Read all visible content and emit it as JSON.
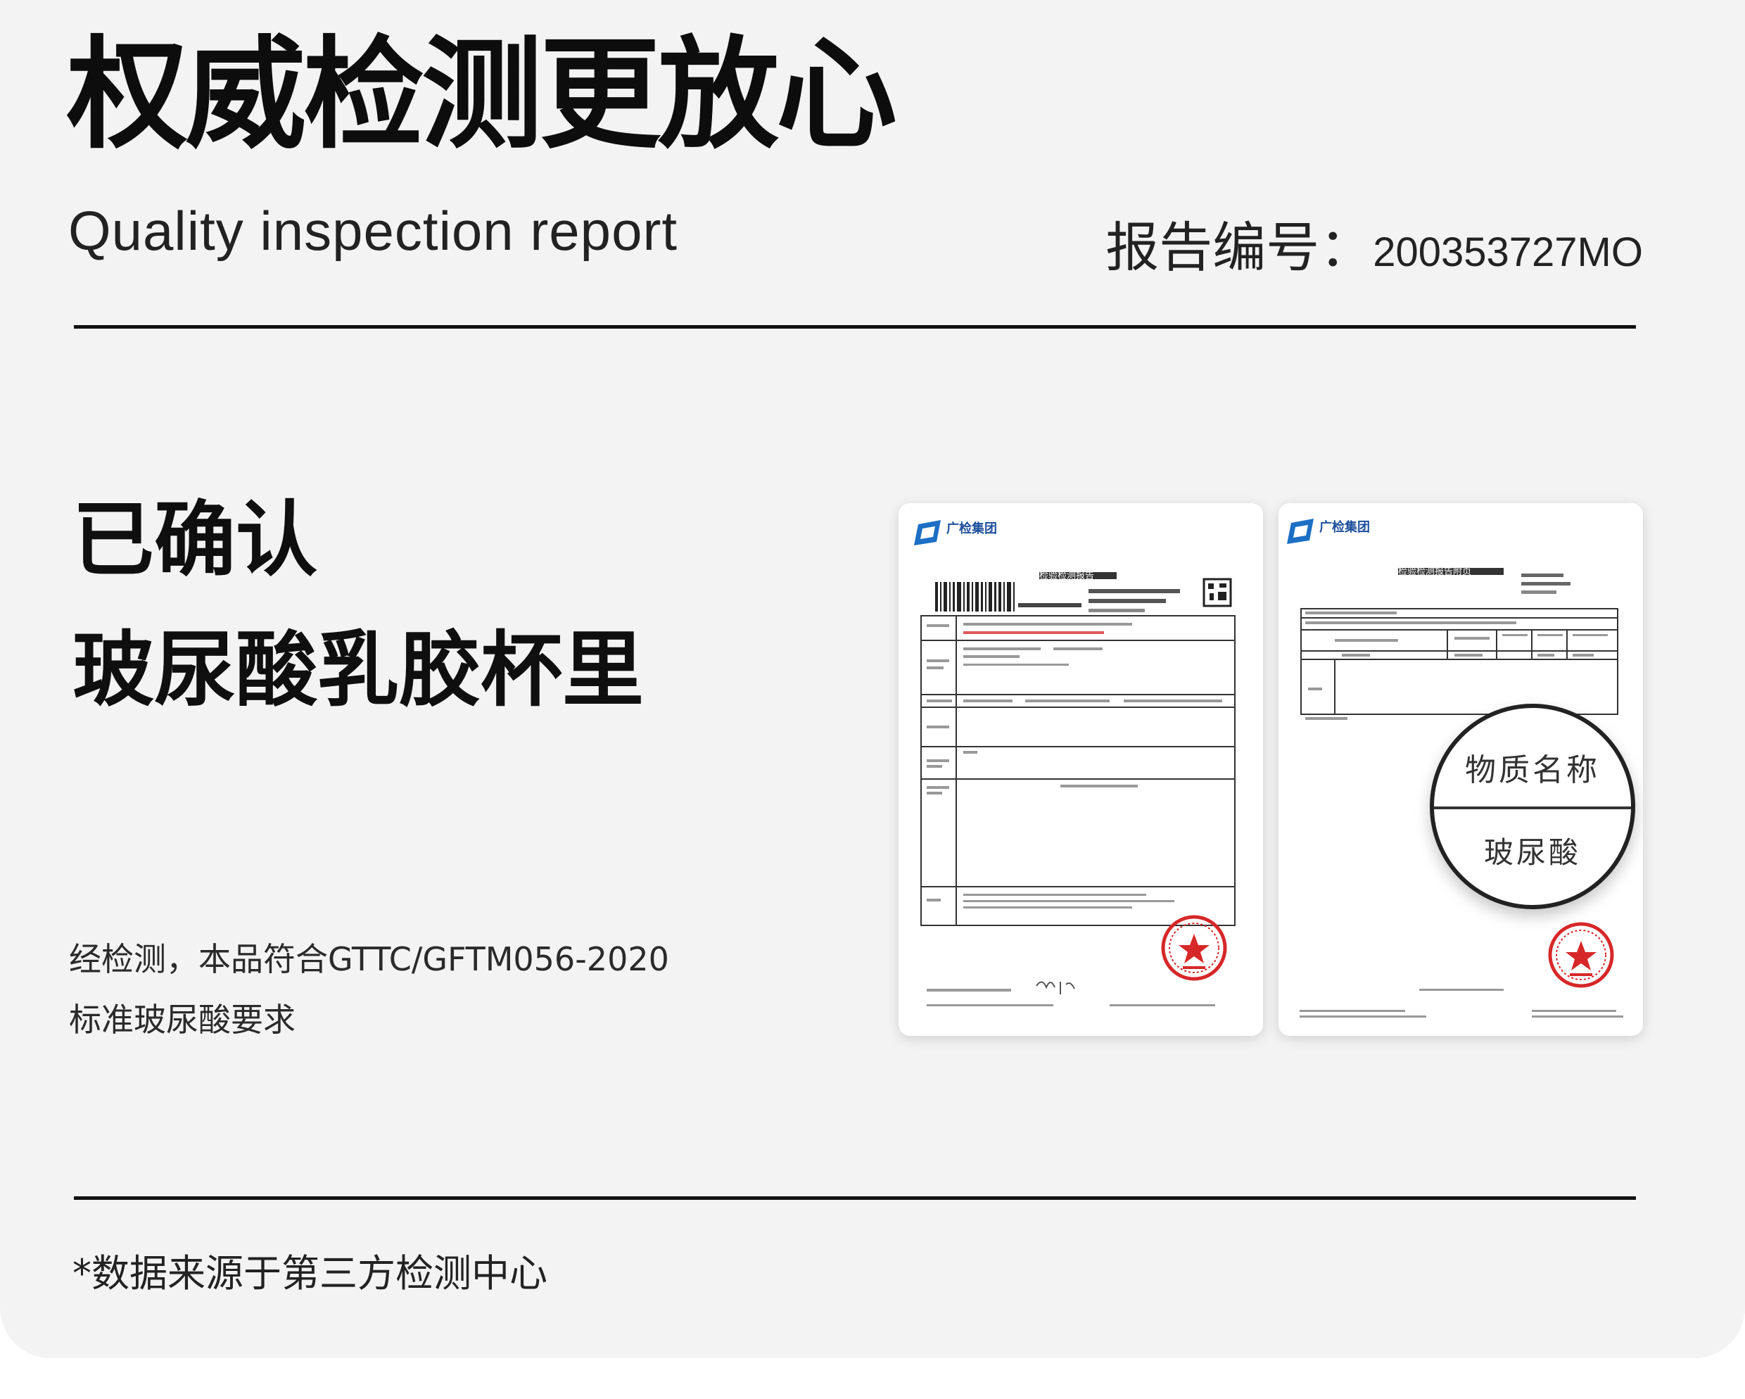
{
  "header": {
    "title": "权威检测更放心",
    "subtitle": "Quality inspection report",
    "report_label": "报告编号：",
    "report_number": "200353727MO"
  },
  "main": {
    "confirm_line1": "已确认",
    "confirm_line2": "玻尿酸乳胶杯里",
    "desc_line1": "经检测，本品符合GTTC/GFTM056-2020",
    "desc_line2": "标准玻尿酸要求"
  },
  "documents": [
    {
      "brand": "广检集团",
      "title": "检验检测报告"
    },
    {
      "brand": "广检集团",
      "title": "检验检测报告附页",
      "magnified_header": "物质名称",
      "magnified_value": "玻尿酸"
    }
  ],
  "footer": {
    "note": "*数据来源于第三方检测中心"
  },
  "colors": {
    "background": "#f3f3f3",
    "text": "#111111",
    "brand_blue": "#1c4e9b",
    "stamp_red": "#d62828"
  }
}
